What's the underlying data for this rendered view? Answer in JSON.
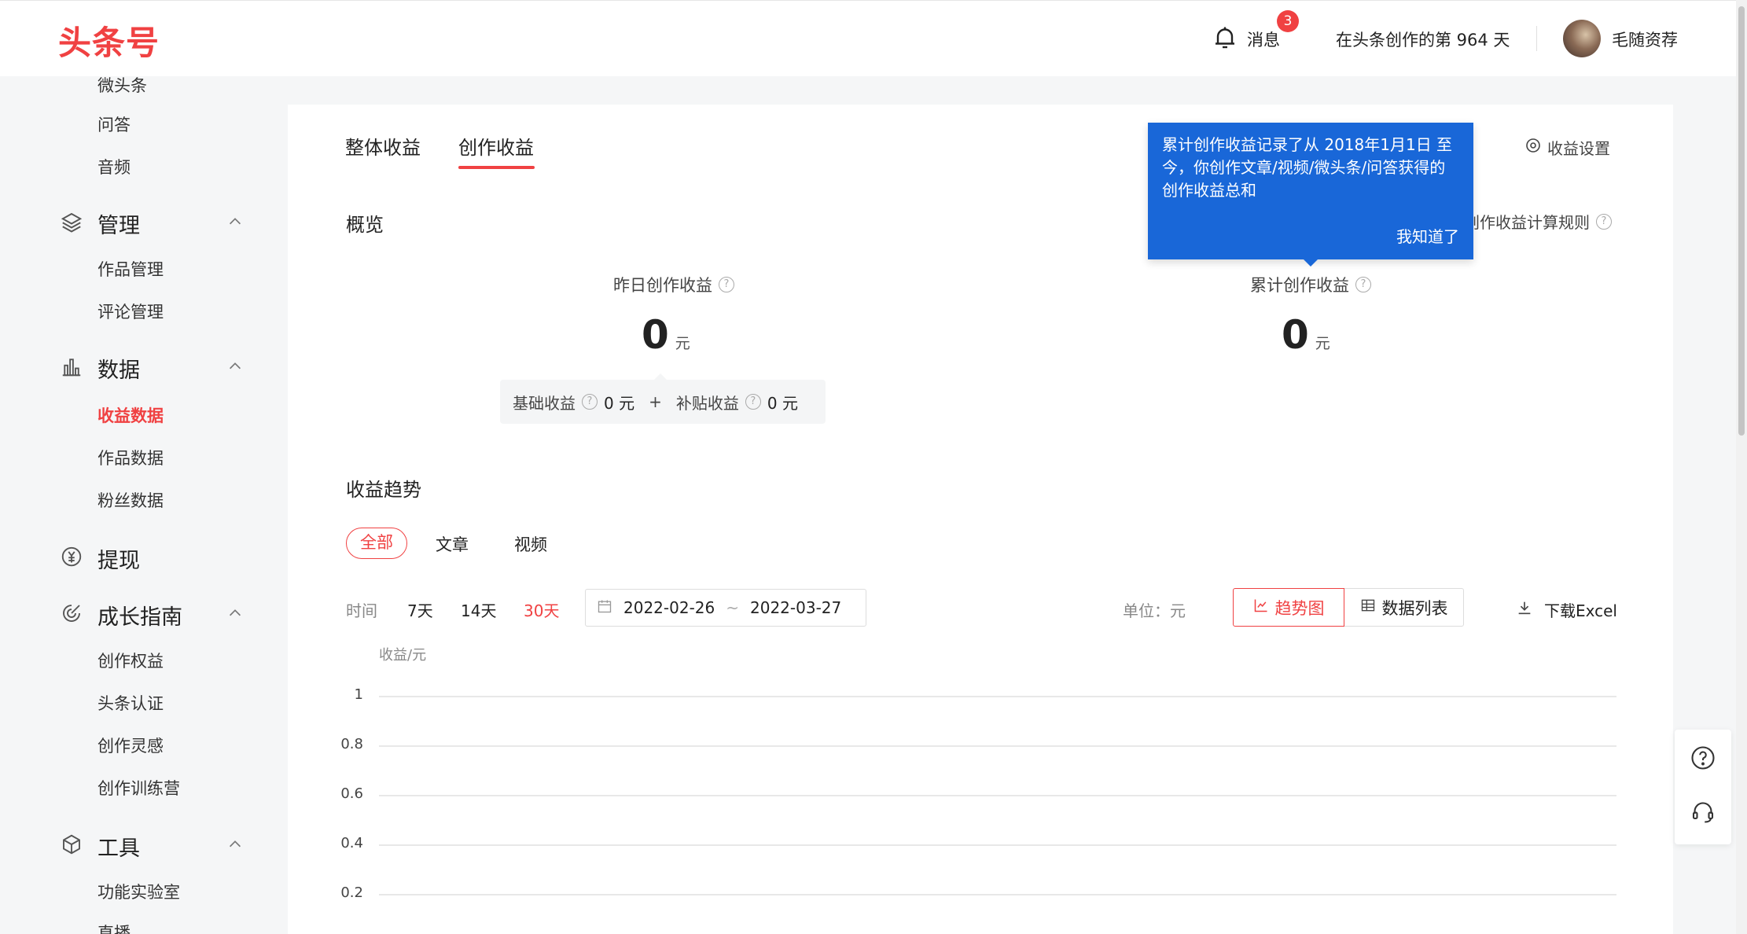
{
  "header": {
    "logo": "头条号",
    "notifications_label": "消息",
    "notifications_count": "3",
    "creation_days": "在头条创作的第 964 天",
    "username": "毛随资荐"
  },
  "sidebar": {
    "top_items": [
      "微头条",
      "问答",
      "音频"
    ],
    "groups": [
      {
        "label": "管理",
        "items": [
          "作品管理",
          "评论管理"
        ]
      },
      {
        "label": "数据",
        "items": [
          "收益数据",
          "作品数据",
          "粉丝数据"
        ]
      },
      {
        "label": "提现",
        "items": []
      },
      {
        "label": "成长指南",
        "items": [
          "创作权益",
          "头条认证",
          "创作灵感",
          "创作训练营"
        ]
      },
      {
        "label": "工具",
        "items": [
          "功能实验室",
          "直播"
        ]
      }
    ],
    "active_item": "收益数据"
  },
  "tabs": [
    {
      "label": "整体收益"
    },
    {
      "label": "创作收益"
    }
  ],
  "settings_label": "收益设置",
  "overview": {
    "title": "概览",
    "rules_link": "创作收益计算规则",
    "yesterday": {
      "label": "昨日创作收益",
      "value": "0",
      "unit": "元"
    },
    "total": {
      "label": "累计创作收益",
      "value": "0",
      "unit": "元"
    },
    "breakdown": {
      "base_label": "基础收益",
      "base_value": "0 元",
      "plus": "+",
      "subsidy_label": "补贴收益",
      "subsidy_value": "0 元"
    }
  },
  "tooltip": {
    "text": "累计创作收益记录了从 2018年1月1日 至今，你创作文章/视频/微头条/问答获得的创作收益总和",
    "confirm": "我知道了"
  },
  "trend": {
    "title": "收益趋势",
    "filters": [
      "全部",
      "文章",
      "视频"
    ],
    "time_label": "时间",
    "ranges": [
      "7天",
      "14天",
      "30天"
    ],
    "active_range": "30天",
    "date_start": "2022-02-26",
    "date_sep": "~",
    "date_end": "2022-03-27",
    "unit_label": "单位：元",
    "view_chart": "趋势图",
    "view_table": "数据列表",
    "download": "下载Excel",
    "y_axis_title": "收益/元",
    "y_ticks": [
      "1",
      "0.8",
      "0.6",
      "0.4",
      "0.2"
    ]
  }
}
